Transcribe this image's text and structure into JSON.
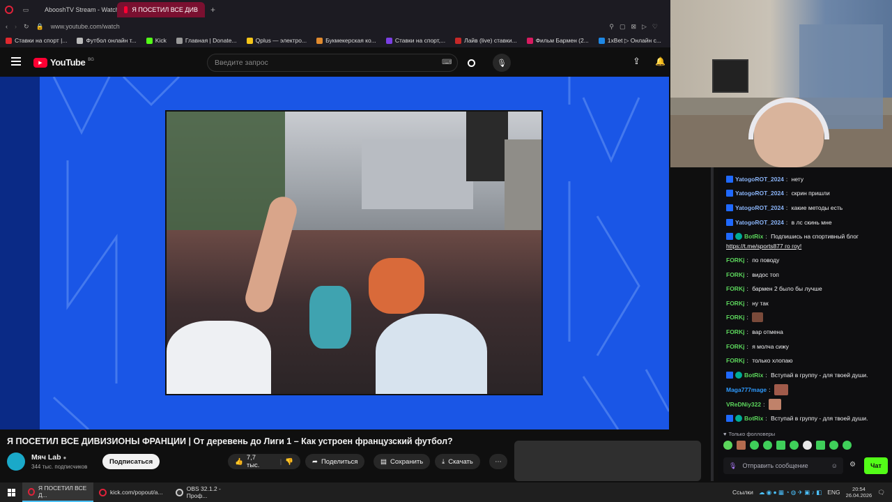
{
  "browser": {
    "tabs": [
      {
        "label": "AbooshTV Stream - Watch"
      },
      {
        "label": "Я ПОСЕТИЛ ВСЕ ДИВ"
      }
    ],
    "url": "www.youtube.com/watch",
    "bookmarks": [
      "Ставки на спорт |...",
      "Футбол онлайн т...",
      "Kick",
      "Главная | Donate...",
      "Qplus — электро...",
      "Букмекерская ко...",
      "Ставки на спорт,...",
      "Лайв (live) ставки...",
      "Фильм Бармен (2...",
      "1xBet ▷ Онлайн с..."
    ]
  },
  "youtube": {
    "logo": "YouTube",
    "region": "BG",
    "search_placeholder": "Введите запрос",
    "video_title": "Я ПОСЕТИЛ ВСЕ ДИВИЗИОНЫ ФРАНЦИИ | От деревень до Лиги 1 – Как устроен французский футбол?",
    "channel": {
      "name": "Мяч Lab",
      "subscribers": "344 тыс. подписчиков",
      "subscribe_label": "Подписаться"
    },
    "actions": {
      "likes": "7,7 тыс.",
      "share": "Поделиться",
      "save": "Сохранить",
      "download": "Скачать"
    }
  },
  "chat": {
    "messages": [
      {
        "user": "YatogoROT_2024",
        "text": "нету",
        "style": "blue"
      },
      {
        "user": "YatogoROT_2024",
        "text": "скрин пришли",
        "style": "blue"
      },
      {
        "user": "YatogoROT_2024",
        "text": "какие методы есть",
        "style": "blue"
      },
      {
        "user": "YatogoROT_2024",
        "text": "в лс скинь мне",
        "style": "blue"
      },
      {
        "user": "BotRix",
        "text": "Подпишись на спортивный блог",
        "style": "bot"
      },
      {
        "user": "",
        "text": "https://t.me/sports877 го гоу!",
        "style": "link"
      },
      {
        "user": "FORKj",
        "text": "по поводу",
        "style": "green"
      },
      {
        "user": "FORKj",
        "text": "видос топ",
        "style": "green"
      },
      {
        "user": "FORKj",
        "text": "бармен 2 было бы лучше",
        "style": "green"
      },
      {
        "user": "FORKj",
        "text": "ну так",
        "style": "green"
      },
      {
        "user": "FORKj",
        "text": "",
        "style": "green"
      },
      {
        "user": "FORKj",
        "text": "вар отмена",
        "style": "green"
      },
      {
        "user": "FORKj",
        "text": "я молча сижу",
        "style": "green"
      },
      {
        "user": "FORKj",
        "text": "только хлопаю",
        "style": "green"
      },
      {
        "user": "BotRix",
        "text": "Вступай в группу - для твоей души.",
        "style": "bot"
      },
      {
        "user": "Maga777mage",
        "text": "",
        "style": "lb"
      },
      {
        "user": "VReDNiy322",
        "text": "",
        "style": "green"
      },
      {
        "user": "BotRix",
        "text": "Вступай в группу - для твоей души.",
        "style": "bot"
      }
    ],
    "followers_only": "Только фолловеры",
    "input_placeholder": "Отправить сообщение",
    "send_label": "Чат"
  },
  "taskbar": {
    "apps": [
      "Я ПОСЕТИЛ ВСЕ Д...",
      "kick.com/popout/a...",
      "OBS 32.1.2 - Проф..."
    ],
    "tray_label": "Ссылки",
    "lang": "ENG",
    "time": "20:54",
    "date": "26.04.2026"
  }
}
